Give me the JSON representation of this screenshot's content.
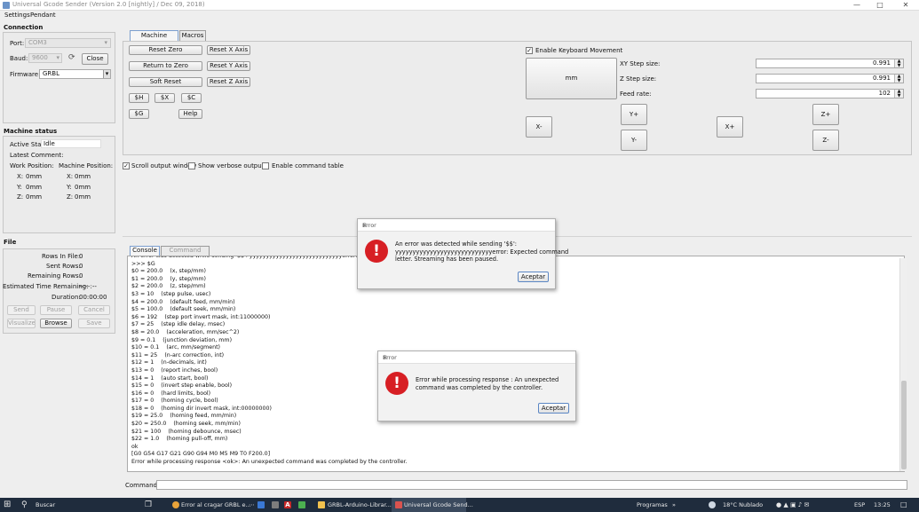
{
  "window": {
    "title": "Universal Gcode Sender (Version 2.0 [nightly]  / Dec 09, 2018)"
  },
  "menu": [
    "Settings",
    "Pendant"
  ],
  "connection": {
    "title": "Connection",
    "port_label": "Port:",
    "port_value": "COM3",
    "baud_label": "Baud:",
    "baud_value": "9600",
    "close_label": "Close",
    "firmware_label": "Firmware:",
    "firmware_value": "GRBL"
  },
  "machine_status": {
    "title": "Machine status",
    "active_state_label": "Active State:",
    "active_state_value": "Idle",
    "latest_comment_label": "Latest Comment:",
    "work_position_label": "Work Position:",
    "machine_position_label": "Machine Position:",
    "work": [
      {
        "axis": "X:",
        "value": "0mm"
      },
      {
        "axis": "Y:",
        "value": "0mm"
      },
      {
        "axis": "Z:",
        "value": "0mm"
      }
    ],
    "machine": [
      {
        "axis": "X:",
        "value": "0mm"
      },
      {
        "axis": "Y:",
        "value": "0mm"
      },
      {
        "axis": "Z:",
        "value": "0mm"
      }
    ]
  },
  "file": {
    "title": "File",
    "rows_in_file_label": "Rows In File:",
    "rows_in_file": "0",
    "sent_rows_label": "Sent Rows:",
    "sent_rows": "0",
    "remaining_rows_label": "Remaining Rows:",
    "remaining_rows": "0",
    "est_time_label": "Estimated Time Remaining:",
    "est_time": "--:--:--",
    "duration_label": "Duration:",
    "duration": "00:00:00",
    "buttons": {
      "send": "Send",
      "pause": "Pause",
      "cancel": "Cancel",
      "visualize": "Visualize",
      "browse": "Browse",
      "save": "Save"
    }
  },
  "tabs": {
    "machine_control": "Machine Control",
    "macros": "Macros"
  },
  "machine_control": {
    "reset_zero": "Reset Zero",
    "reset_x": "Reset X Axis",
    "return_to_zero": "Return to Zero",
    "reset_y": "Reset Y Axis",
    "soft_reset": "Soft Reset",
    "reset_z": "Reset Z Axis",
    "dollar_h": "$H",
    "dollar_x": "$X",
    "dollar_c": "$C",
    "dollar_g": "$G",
    "help": "Help"
  },
  "jog": {
    "enable_keyboard": "Enable Keyboard Movement",
    "units": "mm",
    "xy_step_label": "XY Step size:",
    "xy_step": "0.991",
    "z_step_label": "Z Step size:",
    "z_step": "0.991",
    "feed_rate_label": "Feed rate:",
    "feed_rate": "102",
    "x_minus": "X-",
    "x_plus": "X+",
    "y_plus": "Y+",
    "y_minus": "Y-",
    "z_plus": "Z+",
    "z_minus": "Z-"
  },
  "options": {
    "scroll_output": "Scroll output window",
    "verbose": "Show verbose output",
    "command_table": "Enable command table"
  },
  "console_tabs": {
    "console": "Console",
    "command_table": "Command Table"
  },
  "console_lines": [
    "An error was detected while sending '$$': yyyyyyyyyyyyyyyyyyyyyyyyyyyyerror: Expected cor",
    ">>> $G",
    "$0 = 200.0    (x, step/mm)",
    "$1 = 200.0    (y, step/mm)",
    "$2 = 200.0    (z, step/mm)",
    "$3 = 10    (step pulse, usec)",
    "$4 = 200.0    (default feed, mm/min)",
    "$5 = 100.0    (default seek, mm/min)",
    "$6 = 192    (step port invert mask, int:11000000)",
    "$7 = 25    (step idle delay, msec)",
    "$8 = 20.0    (acceleration, mm/sec^2)",
    "$9 = 0.1    (junction deviation, mm)",
    "$10 = 0.1    (arc, mm/segment)",
    "$11 = 25    (n-arc correction, int)",
    "$12 = 1    (n-decimals, int)",
    "$13 = 0    (report inches, bool)",
    "$14 = 1    (auto start, bool)",
    "$15 = 0    (invert step enable, bool)",
    "$16 = 0    (hard limits, bool)",
    "$17 = 0    (homing cycle, bool)",
    "$18 = 0    (homing dir invert mask, int:00000000)",
    "$19 = 25.0    (homing feed, mm/min)",
    "$20 = 250.0    (homing seek, mm/min)",
    "$21 = 100    (homing debounce, msec)",
    "$22 = 1.0    (homing pull-off, mm)",
    "ok",
    "[G0 G54 G17 G21 G90 G94 M0 M5 M9 T0 F200.0]",
    "Error while processing response <ok>: An unexpected command was completed by the controller."
  ],
  "command_label": "Command:",
  "dialog1": {
    "title": "Error",
    "message": "An error was detected while sending '$$':\nyyyyyyyyyyyyyyyyyyyyyyyyyyyyerror: Expected command\nletter. Streaming has been paused.",
    "button": "Aceptar"
  },
  "dialog2": {
    "title": "Error",
    "message": "Error while processing response : An unexpected\ncommand was completed by the controller.",
    "button": "Aceptar"
  },
  "taskbar": {
    "search": "Buscar",
    "items": [
      "Error al cragar GRBL e...",
      "GRBL-Arduino-Librar...",
      "Universal Gcode Send..."
    ],
    "programs": "Programas",
    "weather": "18°C  Nublado",
    "lang": "ESP",
    "time": "13:25"
  },
  "colors": {
    "error_red": "#d71f24",
    "taskbar": "#1f2c3d"
  }
}
